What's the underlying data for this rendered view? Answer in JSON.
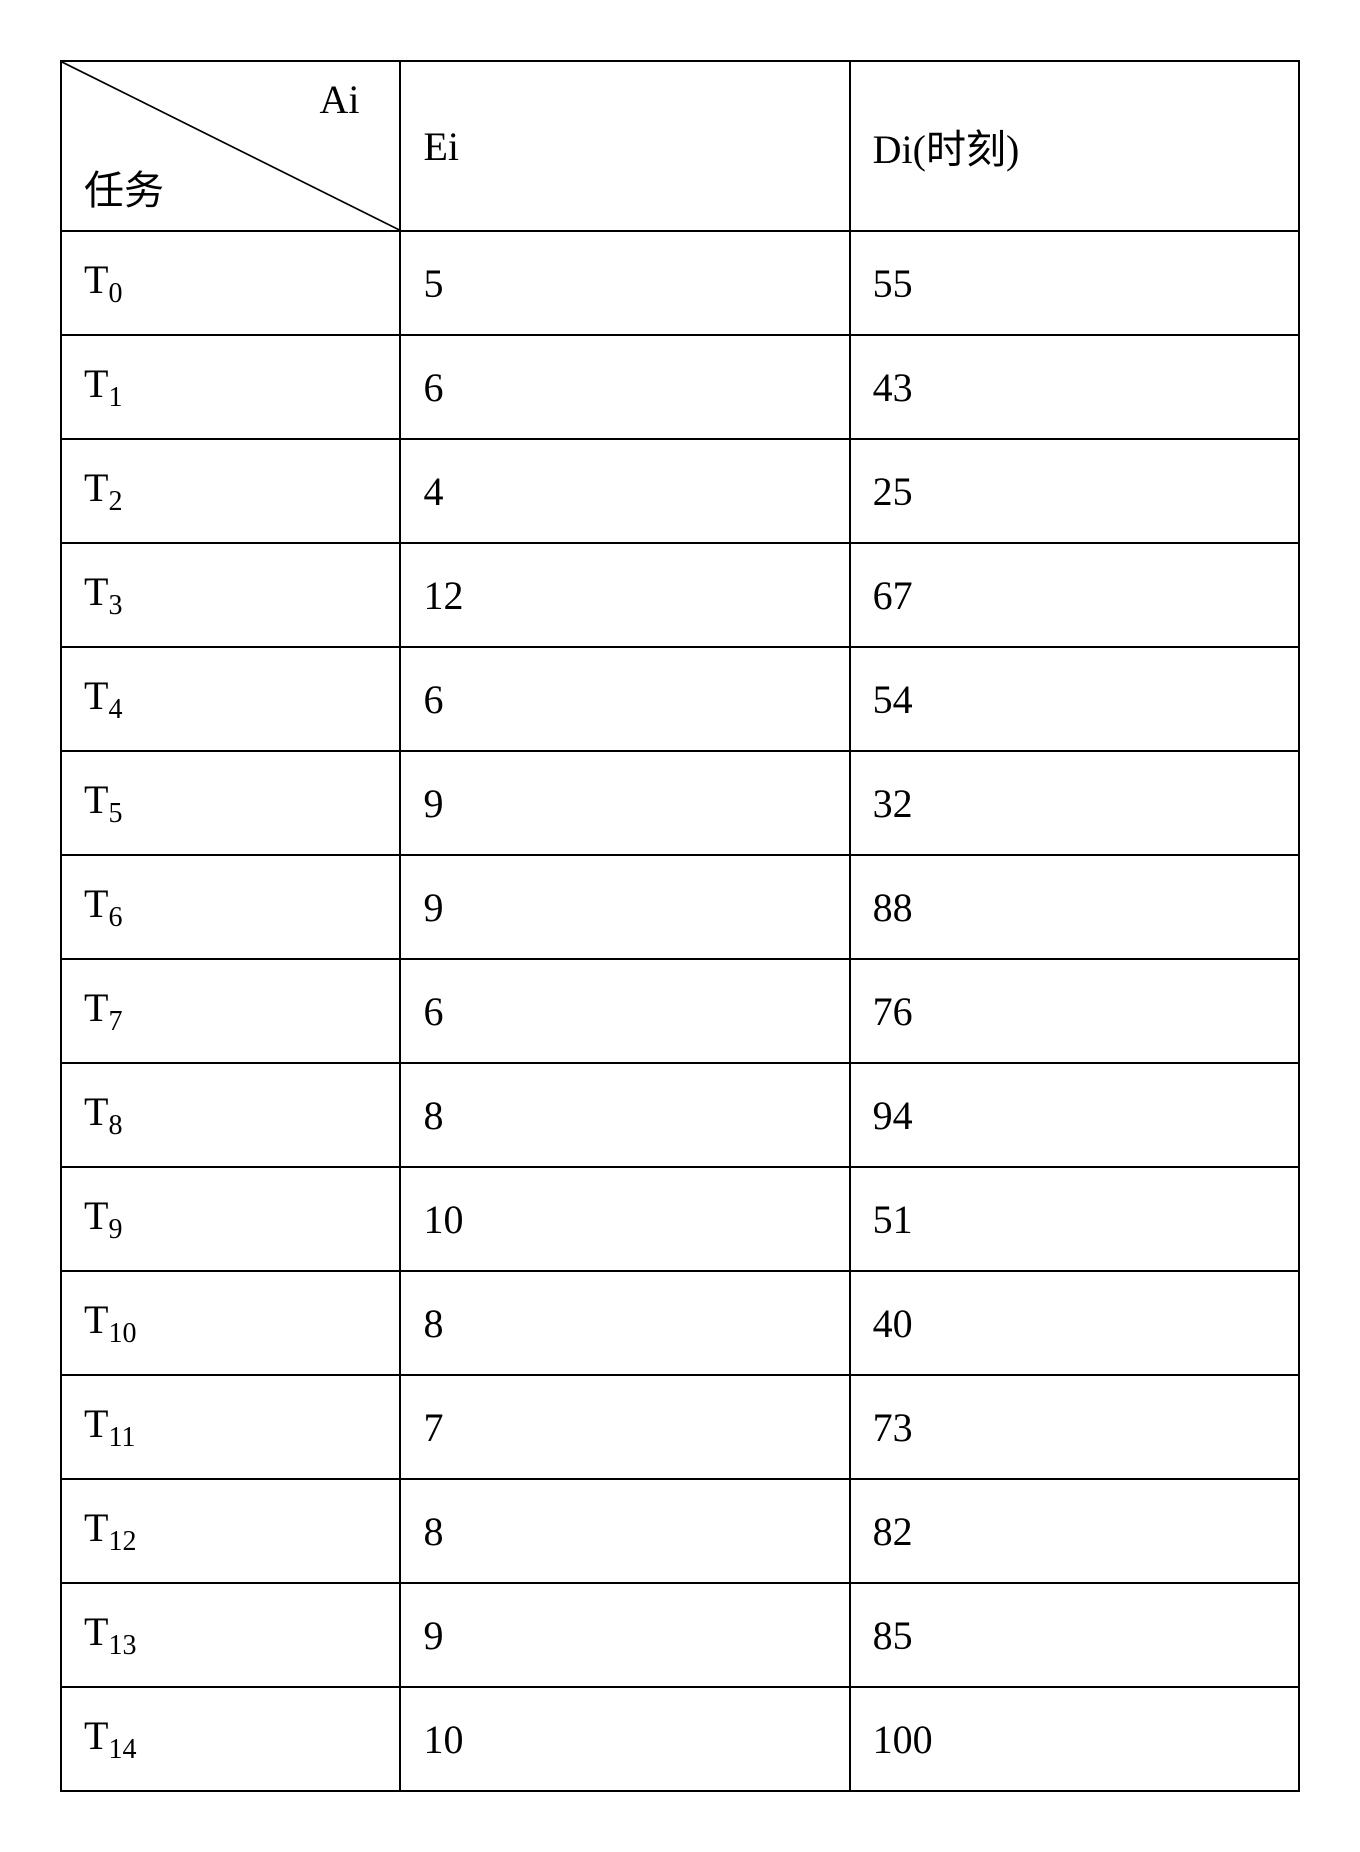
{
  "header": {
    "diag_top": "Ai",
    "diag_bottom": "任务",
    "col2": "Ei",
    "col3": "Di(时刻)"
  },
  "rows": [
    {
      "task_base": "T",
      "task_sub": "0",
      "ei": "5",
      "di": "55"
    },
    {
      "task_base": "T",
      "task_sub": "1",
      "ei": "6",
      "di": "43"
    },
    {
      "task_base": "T",
      "task_sub": "2",
      "ei": "4",
      "di": "25"
    },
    {
      "task_base": "T",
      "task_sub": "3",
      "ei": "12",
      "di": "67"
    },
    {
      "task_base": "T",
      "task_sub": "4",
      "ei": "6",
      "di": "54"
    },
    {
      "task_base": "T",
      "task_sub": "5",
      "ei": "9",
      "di": "32"
    },
    {
      "task_base": "T",
      "task_sub": "6",
      "ei": "9",
      "di": "88"
    },
    {
      "task_base": "T",
      "task_sub": "7",
      "ei": "6",
      "di": "76"
    },
    {
      "task_base": "T",
      "task_sub": "8",
      "ei": "8",
      "di": "94"
    },
    {
      "task_base": "T",
      "task_sub": "9",
      "ei": "10",
      "di": "51"
    },
    {
      "task_base": "T",
      "task_sub": "10",
      "ei": "8",
      "di": "40"
    },
    {
      "task_base": "T",
      "task_sub": "11",
      "ei": "7",
      "di": "73"
    },
    {
      "task_base": "T",
      "task_sub": "12",
      "ei": "8",
      "di": "82"
    },
    {
      "task_base": "T",
      "task_sub": "13",
      "ei": "9",
      "di": "85"
    },
    {
      "task_base": "T",
      "task_sub": "14",
      "ei": "10",
      "di": "100"
    }
  ],
  "chart_data": {
    "type": "table",
    "columns": [
      "任务",
      "Ei",
      "Di(时刻)"
    ],
    "corner_header": {
      "row_label": "任务",
      "col_label": "Ai"
    },
    "rows": [
      {
        "task": "T0",
        "Ei": 5,
        "Di": 55
      },
      {
        "task": "T1",
        "Ei": 6,
        "Di": 43
      },
      {
        "task": "T2",
        "Ei": 4,
        "Di": 25
      },
      {
        "task": "T3",
        "Ei": 12,
        "Di": 67
      },
      {
        "task": "T4",
        "Ei": 6,
        "Di": 54
      },
      {
        "task": "T5",
        "Ei": 9,
        "Di": 32
      },
      {
        "task": "T6",
        "Ei": 9,
        "Di": 88
      },
      {
        "task": "T7",
        "Ei": 6,
        "Di": 76
      },
      {
        "task": "T8",
        "Ei": 8,
        "Di": 94
      },
      {
        "task": "T9",
        "Ei": 10,
        "Di": 51
      },
      {
        "task": "T10",
        "Ei": 8,
        "Di": 40
      },
      {
        "task": "T11",
        "Ei": 7,
        "Di": 73
      },
      {
        "task": "T12",
        "Ei": 8,
        "Di": 82
      },
      {
        "task": "T13",
        "Ei": 9,
        "Di": 85
      },
      {
        "task": "T14",
        "Ei": 10,
        "Di": 100
      }
    ]
  }
}
